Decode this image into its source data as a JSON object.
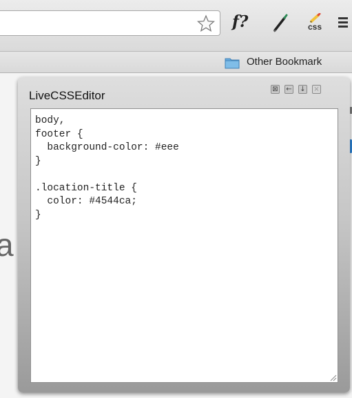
{
  "toolbar": {
    "icons": [
      "star-icon",
      "fquery-icon",
      "pen-icon",
      "css-ext-icon",
      "menu-icon"
    ],
    "fquery_label": "f?",
    "css_ext_label": "css"
  },
  "bookmarks_bar": {
    "items": [
      {
        "label": "Other Bookmark",
        "icon": "folder-icon"
      }
    ]
  },
  "page": {
    "fragment_text": "a"
  },
  "editor": {
    "title": "LiveCSSEditor",
    "window_buttons": [
      "screenshot",
      "back",
      "down",
      "close"
    ],
    "code": "body,\nfooter {\n  background-color: #eee\n}\n\n.location-title {\n  color: #4544ca;\n}"
  },
  "colors": {
    "accent": "#2a7fd0",
    "folder": "#5aa0d8",
    "pen_tip": "#f2c23a"
  }
}
